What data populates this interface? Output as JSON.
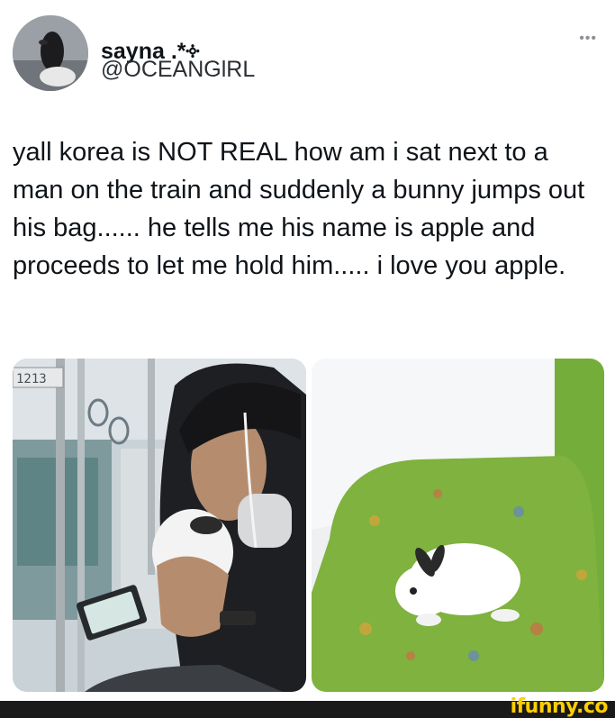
{
  "post": {
    "display_name": "sayna .*༓",
    "handle": "@OCEANGlRL",
    "more_icon": "•••",
    "text": "yall korea is NOT REAL how am i sat next to a man on the train and suddenly a bunny jumps out his bag...... he tells me his name is apple and proceeds to let me hold him..... i love you apple.",
    "photo_left": {
      "car_number": "1213"
    }
  },
  "watermark": {
    "text": "ifunny.co"
  },
  "colors": {
    "text": "#0f1419",
    "watermark": "#ffce00",
    "seat_green": "#7fb23e"
  }
}
